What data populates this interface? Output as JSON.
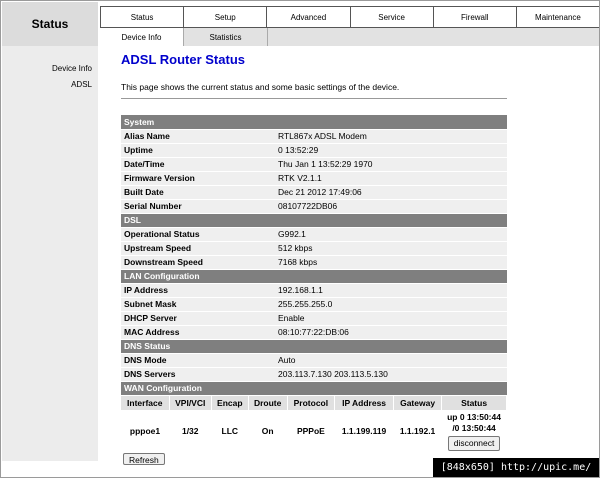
{
  "brand": "Status",
  "top_nav": [
    {
      "label": "Status"
    },
    {
      "label": "Setup"
    },
    {
      "label": "Advanced"
    },
    {
      "label": "Service"
    },
    {
      "label": "Firewall"
    },
    {
      "label": "Maintenance"
    }
  ],
  "sub_nav": [
    {
      "label": "Device Info"
    },
    {
      "label": "Statistics"
    }
  ],
  "sidebar": [
    {
      "label": "Device Info"
    },
    {
      "label": "ADSL"
    }
  ],
  "page": {
    "title": "ADSL Router Status",
    "description": "This page shows the current status and some basic settings of the device."
  },
  "sections": {
    "system": {
      "title": "System",
      "rows": [
        {
          "key": "Alias Name",
          "value": "RTL867x ADSL Modem"
        },
        {
          "key": "Uptime",
          "value": "0 13:52:29"
        },
        {
          "key": "Date/Time",
          "value": "Thu Jan 1 13:52:29 1970"
        },
        {
          "key": "Firmware Version",
          "value": "RTK V2.1.1"
        },
        {
          "key": "Built Date",
          "value": "Dec 21 2012 17:49:06"
        },
        {
          "key": "Serial Number",
          "value": "08107722DB06"
        }
      ]
    },
    "dsl": {
      "title": "DSL",
      "rows": [
        {
          "key": "Operational Status",
          "value": "G992.1"
        },
        {
          "key": "Upstream Speed",
          "value": "512 kbps"
        },
        {
          "key": "Downstream Speed",
          "value": "7168 kbps"
        }
      ]
    },
    "lan": {
      "title": "LAN Configuration",
      "rows": [
        {
          "key": "IP Address",
          "value": "192.168.1.1"
        },
        {
          "key": "Subnet Mask",
          "value": "255.255.255.0"
        },
        {
          "key": "DHCP Server",
          "value": "Enable"
        },
        {
          "key": "MAC Address",
          "value": "08:10:77:22:DB:06"
        }
      ]
    },
    "dns": {
      "title": "DNS Status",
      "rows": [
        {
          "key": "DNS Mode",
          "value": "Auto"
        },
        {
          "key": "DNS Servers",
          "value": "203.113.7.130 203.113.5.130"
        }
      ]
    },
    "wan": {
      "title": "WAN Configuration",
      "headers": [
        "Interface",
        "VPI/VCI",
        "Encap",
        "Droute",
        "Protocol",
        "IP Address",
        "Gateway",
        "Status"
      ],
      "row": {
        "interface": "pppoe1",
        "vpivci": "1/32",
        "encap": "LLC",
        "droute": "On",
        "protocol": "PPPoE",
        "ip": "1.1.199.119",
        "gateway": "1.1.192.1",
        "status_line1": "up 0 13:50:44",
        "status_line2": "/0 13:50:44",
        "action": "disconnect"
      }
    }
  },
  "refresh_label": "Refresh",
  "watermark": "[848x650] http://upic.me/"
}
